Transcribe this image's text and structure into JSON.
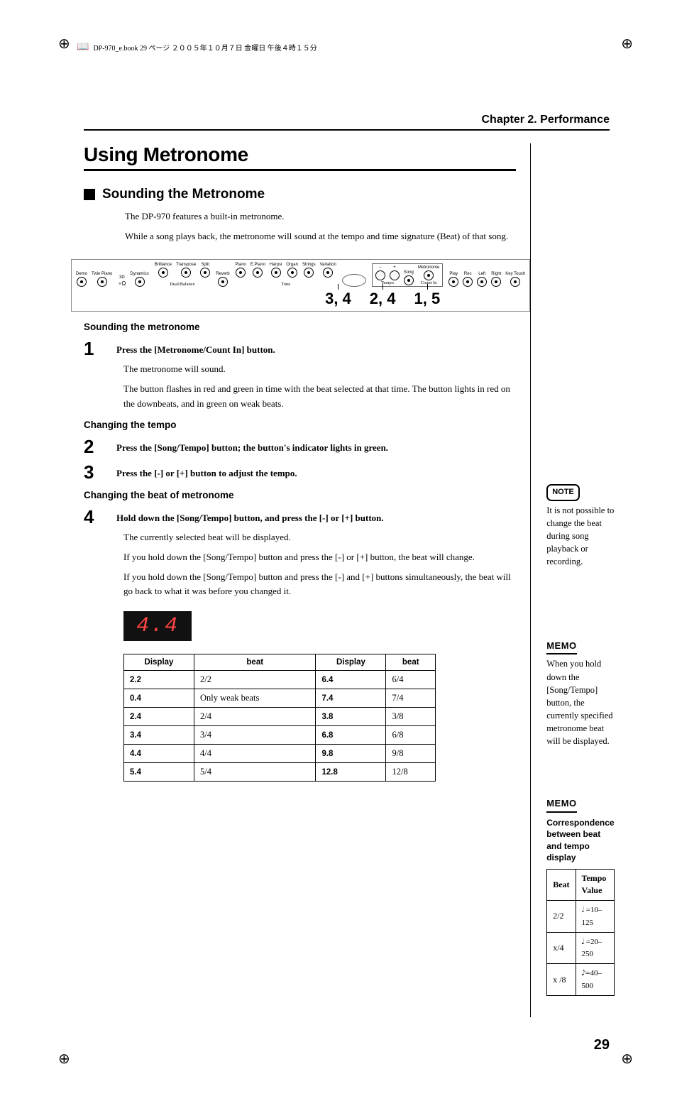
{
  "meta": {
    "header_text": "DP-970_e.book 29 ページ ２００５年１０月７日 金曜日 午後４時１５分"
  },
  "chapter": "Chapter 2. Performance",
  "section_title": "Using Metronome",
  "subsection_title": "Sounding the Metronome",
  "intro": {
    "p1": "The DP-970 features a built-in metronome.",
    "p2": "While a song plays back, the metronome will sound at the tempo and time signature (Beat) of that song."
  },
  "panel": {
    "labels": [
      "Demo",
      "Twin Piano",
      "3D",
      "Dynamics",
      "Brilliance",
      "Transpose",
      "Split",
      "Reverb",
      "Piano",
      "E.Piano",
      "Harpsi",
      "Organ",
      "Strings",
      "Variation",
      "−",
      "+",
      "Song",
      "Metronome",
      "Play",
      "Rec",
      "Left",
      "Right",
      "Key Touch"
    ],
    "sub_labels": {
      "dual_balance": "Dual/Balance",
      "tone": "Tone",
      "tempo": "Tempo",
      "countin": "Count In"
    },
    "refs": [
      "3, 4",
      "2, 4",
      "1, 5"
    ]
  },
  "subheads": {
    "sounding": "Sounding the metronome",
    "tempo": "Changing the tempo",
    "beat": "Changing the beat of metronome"
  },
  "steps": {
    "s1": "Press the [Metronome/Count In] button.",
    "s1_body1": "The metronome will sound.",
    "s1_body2": "The button flashes in red and green in time with the beat selected at that time. The button lights in red on the downbeats, and in green on weak beats.",
    "s2": "Press the [Song/Tempo] button; the button's indicator lights in green.",
    "s3": "Press the [-] or [+] button to adjust the tempo.",
    "s4": "Hold down the [Song/Tempo] button, and press the [-] or [+] button.",
    "s4_body1": "The currently selected beat will be displayed.",
    "s4_body2": "If you hold down the [Song/Tempo] button and press the [-] or [+] button, the beat will change.",
    "s4_body3": "If you hold down the [Song/Tempo] button and press the [-] and [+] buttons simultaneously, the beat will go back to what it was before you changed it."
  },
  "lcd_value": "4.4",
  "beat_table": {
    "headers": [
      "Display",
      "beat",
      "Display",
      "beat"
    ],
    "rows": [
      [
        "2.2",
        "2/2",
        "6.4",
        "6/4"
      ],
      [
        "0.4",
        "Only weak beats",
        "7.4",
        "7/4"
      ],
      [
        "2.4",
        "2/4",
        "3.8",
        "3/8"
      ],
      [
        "3.4",
        "3/4",
        "6.8",
        "6/8"
      ],
      [
        "4.4",
        "4/4",
        "9.8",
        "9/8"
      ],
      [
        "5.4",
        "5/4",
        "12.8",
        "12/8"
      ]
    ]
  },
  "sidebar": {
    "note_label": "NOTE",
    "note_text": "It is not possible to change the beat during song playback or recording.",
    "memo_label": "MEMO",
    "memo1_text": "When you hold down the [Song/Tempo] button, the currently specified metronome beat will be displayed.",
    "corr_head": "Correspondence between beat and tempo display",
    "tempo_table": {
      "headers": [
        "Beat",
        "Tempo Value"
      ],
      "rows": [
        [
          "2/2",
          "𝅗𝅥 =10–125"
        ],
        [
          "x/4",
          "𝅘𝅥 =20–250"
        ],
        [
          "x /8",
          "𝅘𝅥𝅮=40–500"
        ]
      ]
    }
  },
  "page_number": "29"
}
